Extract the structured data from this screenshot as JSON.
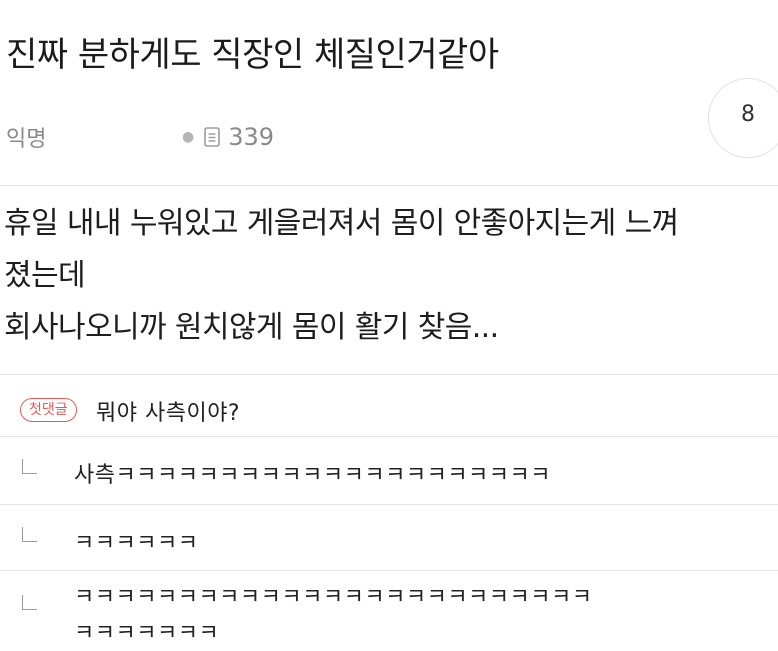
{
  "post": {
    "title": "진짜 분하게도 직장인 체질인거같아",
    "author": "익명",
    "view_icon": "document-icon",
    "views": "339",
    "comment_count": "8",
    "body_lines": [
      "휴일 내내 누워있고 게을러져서 몸이 안좋아지는게 느껴",
      "졌는데",
      "회사나오니까 원치않게 몸이 활기 찾음..."
    ]
  },
  "comments": [
    {
      "badge": "첫댓글",
      "text": "뭐야 사측이야?"
    },
    {
      "reply": true,
      "text": "사측ㅋㅋㅋㅋㅋㅋㅋㅋㅋㅋㅋㅋㅋㅋㅋㅋㅋㅋㅋㅋㅋ"
    },
    {
      "reply": true,
      "text": "ㅋㅋㅋㅋㅋㅋ"
    },
    {
      "reply": true,
      "text_line1": "ㅋㅋㅋㅋㅋㅋㅋㅋㅋㅋㅋㅋㅋㅋㅋㅋㅋㅋㅋㅋㅋㅋㅋㅋㅋ",
      "text_line2": "ㅋㅋㅋㅋㅋㅋㅋ"
    }
  ],
  "colors": {
    "badge": "#e25c5c",
    "divider": "#e4e4e4",
    "meta": "#8a8a8a"
  }
}
